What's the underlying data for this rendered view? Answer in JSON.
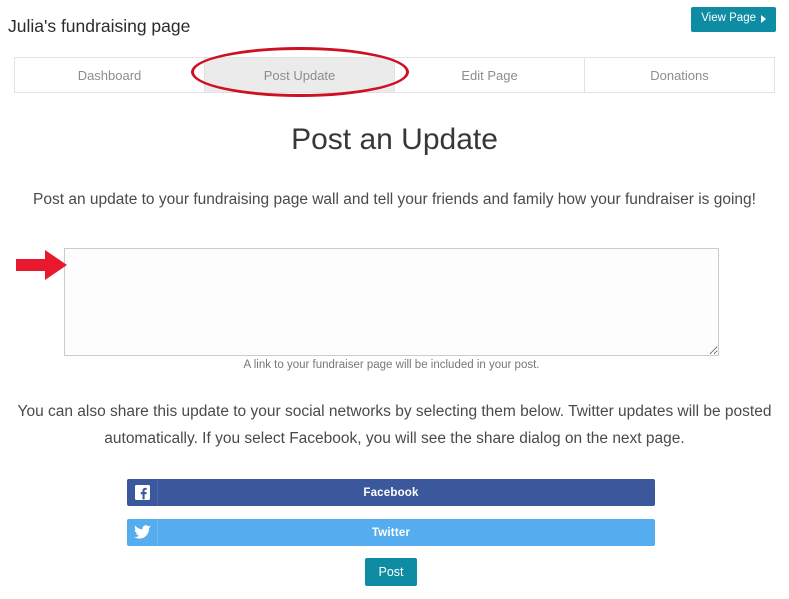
{
  "header": {
    "page_title": "Julia's fundraising page",
    "view_page_label": "View Page",
    "view_page_icon": "caret-right-icon",
    "accent_color": "#0e8ca4"
  },
  "tabs": {
    "items": [
      {
        "label": "Dashboard",
        "active": false
      },
      {
        "label": "Post Update",
        "active": true
      },
      {
        "label": "Edit Page",
        "active": false
      },
      {
        "label": "Donations",
        "active": false
      }
    ],
    "active_tab_bg": "#ebebeb",
    "annotation_color": "#cc1122"
  },
  "main": {
    "heading": "Post an Update",
    "intro_text": "Post an update to your fundraising page wall and tell your friends and family how your fundraiser is going!",
    "textarea": {
      "value": "",
      "placeholder": "",
      "help_text": "A link to your fundraiser page will be included in your post."
    },
    "social_text": "You can also share this update to your social networks by selecting them below. Twitter updates will be posted automatically. If you select Facebook, you will see the share dialog on the next page.",
    "social_buttons": [
      {
        "label": "Facebook",
        "icon": "facebook-icon",
        "color": "#3a589b"
      },
      {
        "label": "Twitter",
        "icon": "twitter-icon",
        "color": "#55acee"
      }
    ],
    "post_button_label": "Post"
  },
  "annotations": {
    "arrow_color": "#e8192c",
    "ellipse_color": "#cc1122"
  }
}
